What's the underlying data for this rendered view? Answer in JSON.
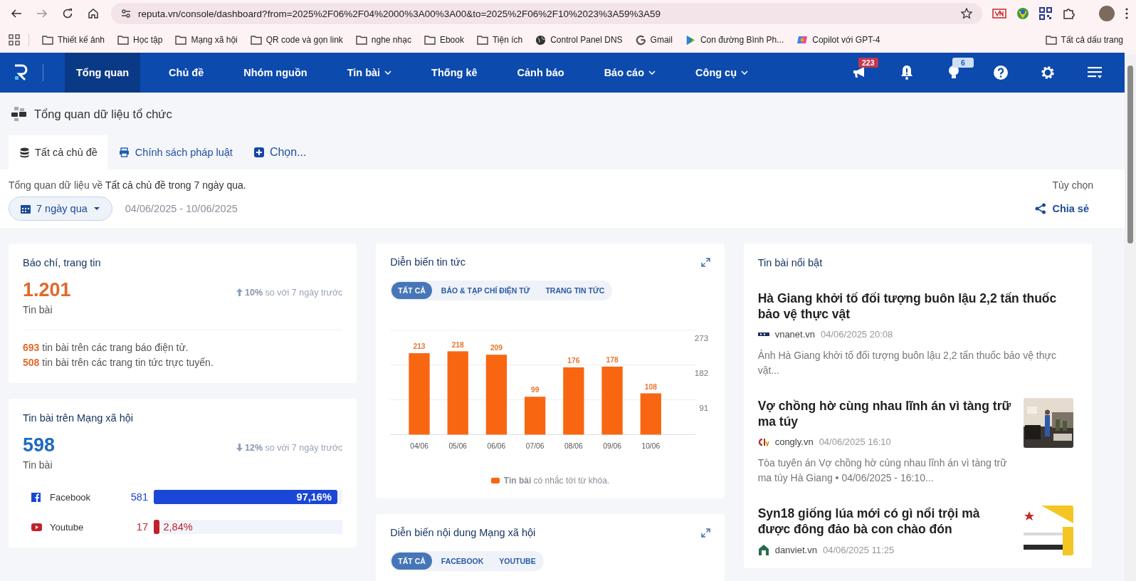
{
  "browser": {
    "url": "reputa.vn/console/dashboard?from=2025%2F06%2F04%2000%3A00%3A00&to=2025%2F06%2F10%2023%3A59%3A59",
    "bookmarks": [
      {
        "label": "Thiết kế ảnh",
        "kind": "folder"
      },
      {
        "label": "Học tập",
        "kind": "folder"
      },
      {
        "label": "Mạng xã hội",
        "kind": "folder"
      },
      {
        "label": "QR code và gọn link",
        "kind": "folder"
      },
      {
        "label": "nghe nhạc",
        "kind": "folder"
      },
      {
        "label": "Ebook",
        "kind": "folder"
      },
      {
        "label": "Tiện ích",
        "kind": "folder"
      },
      {
        "label": "Control Panel DNS",
        "kind": "globe"
      },
      {
        "label": "Gmail",
        "kind": "google"
      },
      {
        "label": "Con đường Bình Ph...",
        "kind": "play"
      },
      {
        "label": "Copilot với GPT-4",
        "kind": "copilot"
      }
    ],
    "all_bookmarks": "Tất cả dấu trang"
  },
  "nav": {
    "items": [
      {
        "label": "Tổng quan",
        "selected": true,
        "dropdown": false
      },
      {
        "label": "Chủ đề",
        "selected": false,
        "dropdown": false
      },
      {
        "label": "Nhóm nguồn",
        "selected": false,
        "dropdown": false
      },
      {
        "label": "Tin bài",
        "selected": false,
        "dropdown": true
      },
      {
        "label": "Thống kê",
        "selected": false,
        "dropdown": false
      },
      {
        "label": "Cảnh báo",
        "selected": false,
        "dropdown": false
      },
      {
        "label": "Báo cáo",
        "selected": false,
        "dropdown": true
      },
      {
        "label": "Công cụ",
        "selected": false,
        "dropdown": true
      }
    ],
    "actions": [
      {
        "kind": "megaphone",
        "badge": "223"
      },
      {
        "kind": "bell"
      },
      {
        "kind": "bulb",
        "badge": "6"
      },
      {
        "kind": "help"
      },
      {
        "kind": "settings"
      },
      {
        "kind": "menu"
      }
    ]
  },
  "page_title": "Tổng quan dữ liệu tổ chức",
  "tabs": [
    {
      "label": "Tất cả chủ đề",
      "kind": "database",
      "selected": true
    },
    {
      "label": "Chính sách pháp luật",
      "kind": "printer",
      "selected": false
    },
    {
      "label": "Chọn...",
      "kind": "add",
      "selected": false
    }
  ],
  "summary": "Tổng quan dữ liệu về **Tất cả chủ đề trong 7 ngày qua.**",
  "period": "7 ngày qua",
  "date_range": "04/06/2025 - 10/06/2025",
  "options": "Tùy chọn",
  "share": "Chia sẻ",
  "press": {
    "title": "Báo chí, trang tin",
    "total": "1.201",
    "total_label": "Tin bài",
    "change": {
      "kind": "up",
      "value": "10%",
      "text": "so với 7 ngày trước"
    },
    "breakdown": [
      {
        "count": "693",
        "text": "tin bài trên các trang báo điện tử."
      },
      {
        "count": "508",
        "text": "tin bài trên các trang tin tức trực tuyến."
      }
    ]
  },
  "social": {
    "title": "Tin bài trên Mạng xã hội",
    "total": "598",
    "total_label": "Tin bài",
    "change": {
      "kind": "down",
      "value": "12%",
      "text": "so với 7 ngày trước"
    },
    "platforms": [
      {
        "name": "Facebook",
        "kind": "facebook",
        "count": "581",
        "percent": "97,16%",
        "level": 0.9716,
        "color": "#1a47d6"
      },
      {
        "name": "Youtube",
        "kind": "youtube",
        "count": "17",
        "percent": "2,84%",
        "level": 0.0284,
        "color": "#c0222c"
      }
    ]
  },
  "news_chart": {
    "title": "Diễn biến tin tức",
    "filters": [
      {
        "label": "TẤT CẢ",
        "selected": true
      },
      {
        "label": "BÁO & TẠP CHÍ ĐIỆN TỬ",
        "selected": false
      },
      {
        "label": "TRANG TIN TỨC",
        "selected": false
      }
    ],
    "chart_data": {
      "type": "bar",
      "categories": [
        "04/06",
        "05/06",
        "06/06",
        "07/06",
        "08/06",
        "09/06",
        "10/06"
      ],
      "series": [
        {
          "name": "Tin bài",
          "color": "#f96612",
          "values": [
            213,
            218,
            209,
            99,
            176,
            178,
            108
          ]
        }
      ],
      "ylim": [
        0,
        273
      ],
      "yticks": [
        91,
        182,
        273
      ],
      "data_labels": true
    },
    "legend_note": "có nhắc tới từ khóa."
  },
  "social_chart": {
    "title": "Diễn biến nội dung Mạng xã hội",
    "filters": [
      {
        "label": "TẤT CẢ",
        "selected": true
      },
      {
        "label": "FACEBOOK",
        "selected": false
      },
      {
        "label": "YOUTUBE",
        "selected": false
      }
    ]
  },
  "featured": {
    "title": "Tin bài nổi bật",
    "articles": [
      {
        "title": "Hà Giang khởi tố đối tượng buôn lậu 2,2 tấn thuốc bảo vệ thực vật",
        "source": {
          "name": "vnanet.vn",
          "kind": "bars"
        },
        "time": "04/06/2025 20:08",
        "excerpt": "Ảnh Hà Giang khởi tố đối tượng buôn lậu 2,2 tấn thuốc bảo vệ thực vật..."
      },
      {
        "title": "Vợ chồng hờ cùng nhau lĩnh án vì tàng trữ ma túy",
        "source": {
          "name": "congly.vn",
          "kind": "mark"
        },
        "time": "04/06/2025 16:10",
        "excerpt": "Tòa tuyên án Vợ chồng hờ cùng nhau lĩnh án vì tàng trữ ma túy Hà Giang • 04/06/2025 - 16:10..."
      },
      {
        "title": "Syn18 giống lúa mới có gì nổi trội mà được đông đảo bà con chào đón",
        "source": {
          "name": "danviet.vn",
          "kind": "house"
        },
        "time": "04/06/2025 11:25"
      }
    ]
  }
}
